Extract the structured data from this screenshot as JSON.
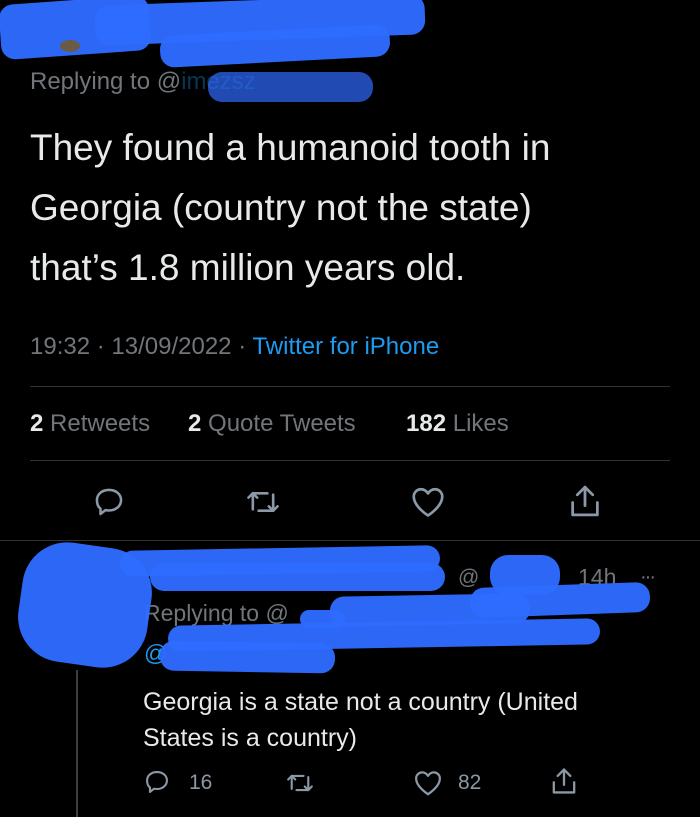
{
  "tweet": {
    "replying_prefix": "Replying to @",
    "replying_handle": "imezsz",
    "body": [
      "They found a humanoid tooth in",
      "Georgia (country not the state)",
      "that’s 1.8 million years old."
    ],
    "time": "19:32",
    "date": "13/09/2022",
    "source": "Twitter for iPhone",
    "sep": "·",
    "stats": {
      "retweets_count": "2",
      "retweets_label": "Retweets",
      "quotes_count": "2",
      "quotes_label": "Quote Tweets",
      "likes_count": "182",
      "likes_label": "Likes"
    }
  },
  "reply": {
    "handle_at": "@",
    "time": "14h",
    "more": "···",
    "replying_prefix": "Replying to @",
    "mention_at": "@",
    "body": [
      "Georgia is a state not a country (United",
      "States is a country)"
    ],
    "replies": "16",
    "likes": "82"
  },
  "colors": {
    "accent": "#1d9bf0",
    "scribble": "#2f6bff",
    "muted": "#71767b"
  },
  "icons": [
    "reply-icon",
    "retweet-icon",
    "like-icon",
    "share-icon",
    "more-icon"
  ]
}
